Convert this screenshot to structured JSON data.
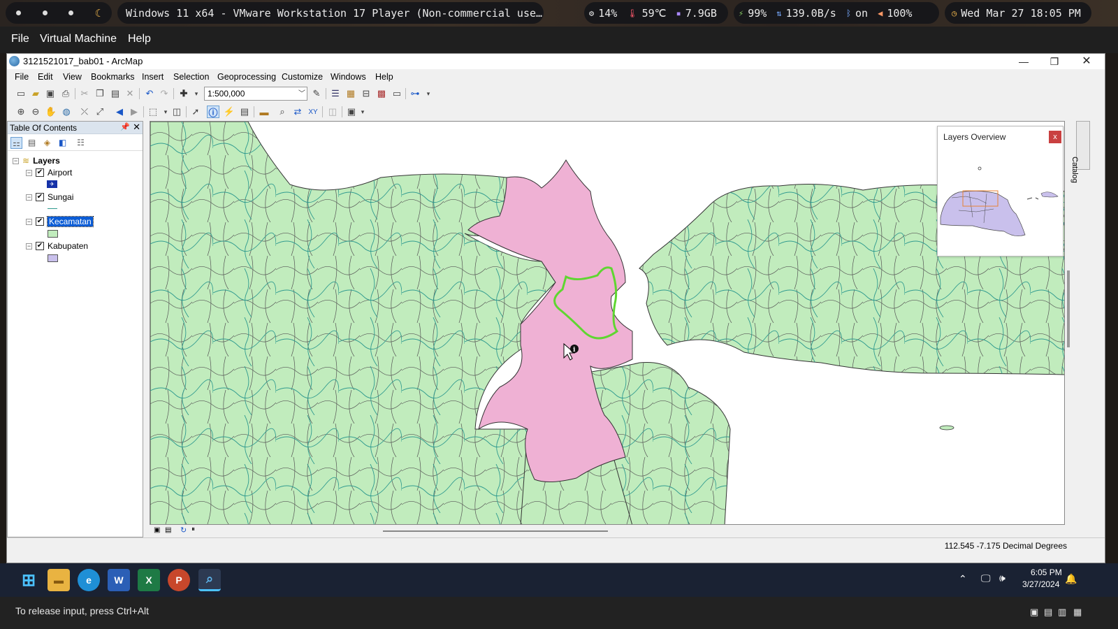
{
  "host": {
    "window_title": "Windows 11 x64 - VMware Workstation 17 Player (Non-commercial use…",
    "stats": {
      "cpu": "14%",
      "temp": "59℃",
      "memory": "7.9GB",
      "battery": "99%",
      "network": "139.0B/s",
      "bluetooth": "on",
      "volume": "100%"
    },
    "datetime": "Wed Mar 27 18:05 PM",
    "icons": {
      "cpu": "cpu-icon",
      "temp": "thermometer-icon",
      "memory": "memory-icon",
      "battery": "battery-icon",
      "network": "network-icon",
      "bluetooth": "bluetooth-icon",
      "volume": "speaker-icon",
      "clock": "clock-icon"
    }
  },
  "vm_menu": [
    "File",
    "Virtual Machine",
    "Help"
  ],
  "arcmap": {
    "title": "3121521017_bab01 - ArcMap",
    "menu": [
      "File",
      "Edit",
      "View",
      "Bookmarks",
      "Insert",
      "Selection",
      "Geoprocessing",
      "Customize",
      "Windows",
      "Help"
    ],
    "scale": "1:500,000",
    "toc": {
      "title": "Table Of Contents",
      "root": "Layers",
      "layers": [
        {
          "name": "Airport",
          "checked": true,
          "symbol": "airport-symbol"
        },
        {
          "name": "Sungai",
          "checked": true,
          "symbol": "river-line-symbol"
        },
        {
          "name": "Kecamatan",
          "checked": true,
          "selected": true,
          "color": "#c1ecbd"
        },
        {
          "name": "Kabupaten",
          "checked": true,
          "color": "#c9c0ec"
        }
      ]
    },
    "overview": {
      "title": "Layers Overview",
      "close": "x"
    },
    "catalog_tab": "Catalog",
    "coords": "112.545  -7.175 Decimal Degrees",
    "colors": {
      "land": "#c1ecbd",
      "selected": "#efb1d4",
      "highlight": "#5fd631",
      "river": "#2f9a8e",
      "kabupaten": "#c9c0ec"
    }
  },
  "taskbar": {
    "apps": [
      "start-icon",
      "file-explorer-icon",
      "edge-icon",
      "word-icon",
      "excel-icon",
      "powerpoint-icon",
      "arcmap-icon"
    ],
    "time": "6:05 PM",
    "date": "3/27/2024"
  },
  "vm_status": "To release input, press Ctrl+Alt"
}
